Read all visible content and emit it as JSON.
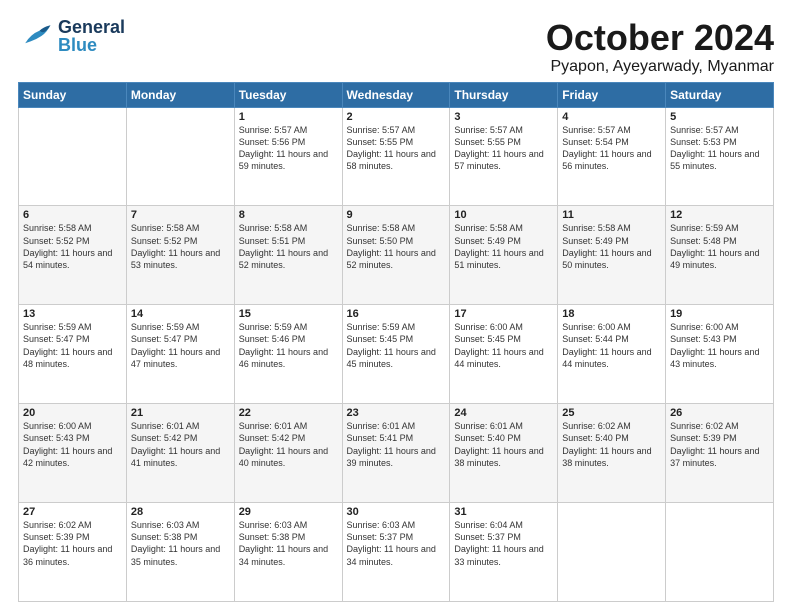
{
  "header": {
    "logo_general": "General",
    "logo_blue": "Blue",
    "month_title": "October 2024",
    "location": "Pyapon, Ayeyarwady, Myanmar"
  },
  "weekdays": [
    "Sunday",
    "Monday",
    "Tuesday",
    "Wednesday",
    "Thursday",
    "Friday",
    "Saturday"
  ],
  "weeks": [
    [
      {
        "day": "",
        "sunrise": "",
        "sunset": "",
        "daylight": ""
      },
      {
        "day": "",
        "sunrise": "",
        "sunset": "",
        "daylight": ""
      },
      {
        "day": "1",
        "sunrise": "Sunrise: 5:57 AM",
        "sunset": "Sunset: 5:56 PM",
        "daylight": "Daylight: 11 hours and 59 minutes."
      },
      {
        "day": "2",
        "sunrise": "Sunrise: 5:57 AM",
        "sunset": "Sunset: 5:55 PM",
        "daylight": "Daylight: 11 hours and 58 minutes."
      },
      {
        "day": "3",
        "sunrise": "Sunrise: 5:57 AM",
        "sunset": "Sunset: 5:55 PM",
        "daylight": "Daylight: 11 hours and 57 minutes."
      },
      {
        "day": "4",
        "sunrise": "Sunrise: 5:57 AM",
        "sunset": "Sunset: 5:54 PM",
        "daylight": "Daylight: 11 hours and 56 minutes."
      },
      {
        "day": "5",
        "sunrise": "Sunrise: 5:57 AM",
        "sunset": "Sunset: 5:53 PM",
        "daylight": "Daylight: 11 hours and 55 minutes."
      }
    ],
    [
      {
        "day": "6",
        "sunrise": "Sunrise: 5:58 AM",
        "sunset": "Sunset: 5:52 PM",
        "daylight": "Daylight: 11 hours and 54 minutes."
      },
      {
        "day": "7",
        "sunrise": "Sunrise: 5:58 AM",
        "sunset": "Sunset: 5:52 PM",
        "daylight": "Daylight: 11 hours and 53 minutes."
      },
      {
        "day": "8",
        "sunrise": "Sunrise: 5:58 AM",
        "sunset": "Sunset: 5:51 PM",
        "daylight": "Daylight: 11 hours and 52 minutes."
      },
      {
        "day": "9",
        "sunrise": "Sunrise: 5:58 AM",
        "sunset": "Sunset: 5:50 PM",
        "daylight": "Daylight: 11 hours and 52 minutes."
      },
      {
        "day": "10",
        "sunrise": "Sunrise: 5:58 AM",
        "sunset": "Sunset: 5:49 PM",
        "daylight": "Daylight: 11 hours and 51 minutes."
      },
      {
        "day": "11",
        "sunrise": "Sunrise: 5:58 AM",
        "sunset": "Sunset: 5:49 PM",
        "daylight": "Daylight: 11 hours and 50 minutes."
      },
      {
        "day": "12",
        "sunrise": "Sunrise: 5:59 AM",
        "sunset": "Sunset: 5:48 PM",
        "daylight": "Daylight: 11 hours and 49 minutes."
      }
    ],
    [
      {
        "day": "13",
        "sunrise": "Sunrise: 5:59 AM",
        "sunset": "Sunset: 5:47 PM",
        "daylight": "Daylight: 11 hours and 48 minutes."
      },
      {
        "day": "14",
        "sunrise": "Sunrise: 5:59 AM",
        "sunset": "Sunset: 5:47 PM",
        "daylight": "Daylight: 11 hours and 47 minutes."
      },
      {
        "day": "15",
        "sunrise": "Sunrise: 5:59 AM",
        "sunset": "Sunset: 5:46 PM",
        "daylight": "Daylight: 11 hours and 46 minutes."
      },
      {
        "day": "16",
        "sunrise": "Sunrise: 5:59 AM",
        "sunset": "Sunset: 5:45 PM",
        "daylight": "Daylight: 11 hours and 45 minutes."
      },
      {
        "day": "17",
        "sunrise": "Sunrise: 6:00 AM",
        "sunset": "Sunset: 5:45 PM",
        "daylight": "Daylight: 11 hours and 44 minutes."
      },
      {
        "day": "18",
        "sunrise": "Sunrise: 6:00 AM",
        "sunset": "Sunset: 5:44 PM",
        "daylight": "Daylight: 11 hours and 44 minutes."
      },
      {
        "day": "19",
        "sunrise": "Sunrise: 6:00 AM",
        "sunset": "Sunset: 5:43 PM",
        "daylight": "Daylight: 11 hours and 43 minutes."
      }
    ],
    [
      {
        "day": "20",
        "sunrise": "Sunrise: 6:00 AM",
        "sunset": "Sunset: 5:43 PM",
        "daylight": "Daylight: 11 hours and 42 minutes."
      },
      {
        "day": "21",
        "sunrise": "Sunrise: 6:01 AM",
        "sunset": "Sunset: 5:42 PM",
        "daylight": "Daylight: 11 hours and 41 minutes."
      },
      {
        "day": "22",
        "sunrise": "Sunrise: 6:01 AM",
        "sunset": "Sunset: 5:42 PM",
        "daylight": "Daylight: 11 hours and 40 minutes."
      },
      {
        "day": "23",
        "sunrise": "Sunrise: 6:01 AM",
        "sunset": "Sunset: 5:41 PM",
        "daylight": "Daylight: 11 hours and 39 minutes."
      },
      {
        "day": "24",
        "sunrise": "Sunrise: 6:01 AM",
        "sunset": "Sunset: 5:40 PM",
        "daylight": "Daylight: 11 hours and 38 minutes."
      },
      {
        "day": "25",
        "sunrise": "Sunrise: 6:02 AM",
        "sunset": "Sunset: 5:40 PM",
        "daylight": "Daylight: 11 hours and 38 minutes."
      },
      {
        "day": "26",
        "sunrise": "Sunrise: 6:02 AM",
        "sunset": "Sunset: 5:39 PM",
        "daylight": "Daylight: 11 hours and 37 minutes."
      }
    ],
    [
      {
        "day": "27",
        "sunrise": "Sunrise: 6:02 AM",
        "sunset": "Sunset: 5:39 PM",
        "daylight": "Daylight: 11 hours and 36 minutes."
      },
      {
        "day": "28",
        "sunrise": "Sunrise: 6:03 AM",
        "sunset": "Sunset: 5:38 PM",
        "daylight": "Daylight: 11 hours and 35 minutes."
      },
      {
        "day": "29",
        "sunrise": "Sunrise: 6:03 AM",
        "sunset": "Sunset: 5:38 PM",
        "daylight": "Daylight: 11 hours and 34 minutes."
      },
      {
        "day": "30",
        "sunrise": "Sunrise: 6:03 AM",
        "sunset": "Sunset: 5:37 PM",
        "daylight": "Daylight: 11 hours and 34 minutes."
      },
      {
        "day": "31",
        "sunrise": "Sunrise: 6:04 AM",
        "sunset": "Sunset: 5:37 PM",
        "daylight": "Daylight: 11 hours and 33 minutes."
      },
      {
        "day": "",
        "sunrise": "",
        "sunset": "",
        "daylight": ""
      },
      {
        "day": "",
        "sunrise": "",
        "sunset": "",
        "daylight": ""
      }
    ]
  ]
}
